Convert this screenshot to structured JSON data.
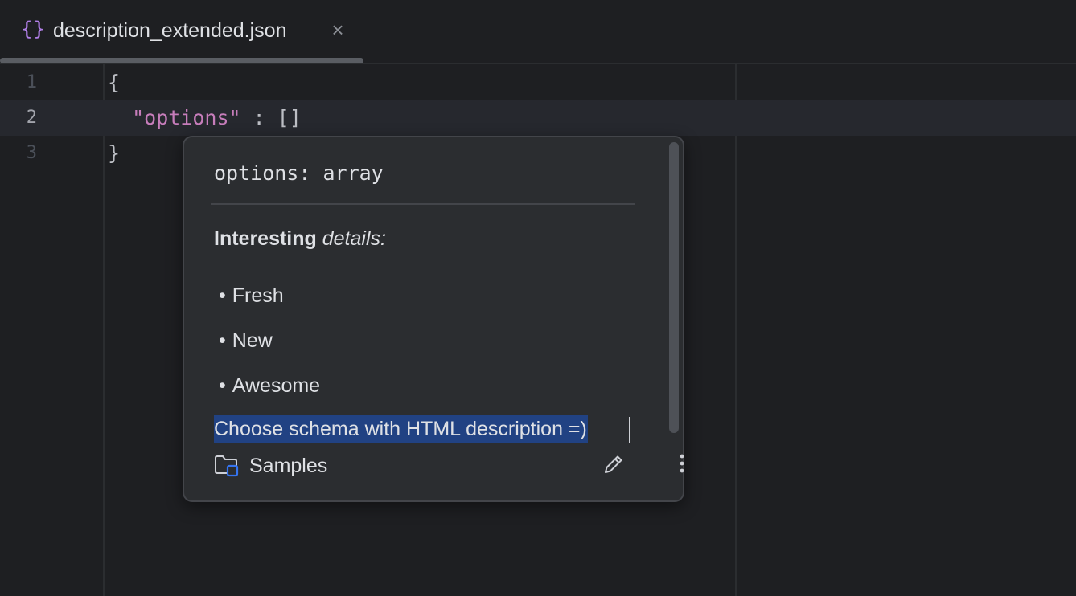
{
  "tab": {
    "icon": "{}",
    "filename": "description_extended.json",
    "close": "×"
  },
  "editor": {
    "lines": [
      {
        "number": "1",
        "code": "{"
      },
      {
        "number": "2",
        "key": "\"options\"",
        "rest": " : []"
      },
      {
        "number": "3",
        "code": "}"
      }
    ]
  },
  "popup": {
    "signature": "options: array",
    "detail_bold": "Interesting",
    "detail_italic": "details:",
    "bullets": [
      "Fresh",
      "New",
      "Awesome"
    ],
    "bullet_char": "•",
    "selected_text": "Choose schema with HTML description =)",
    "source": "Samples",
    "icons": {
      "folder": "folder-icon",
      "edit": "pencil-icon",
      "more": "more-vertical-icon"
    }
  },
  "colors": {
    "background": "#1e1f22",
    "popup_background": "#2b2d30",
    "string_key": "#c77dbb",
    "selection": "#214283",
    "json_icon": "#b07ee6",
    "folder_badge": "#3574f0"
  }
}
